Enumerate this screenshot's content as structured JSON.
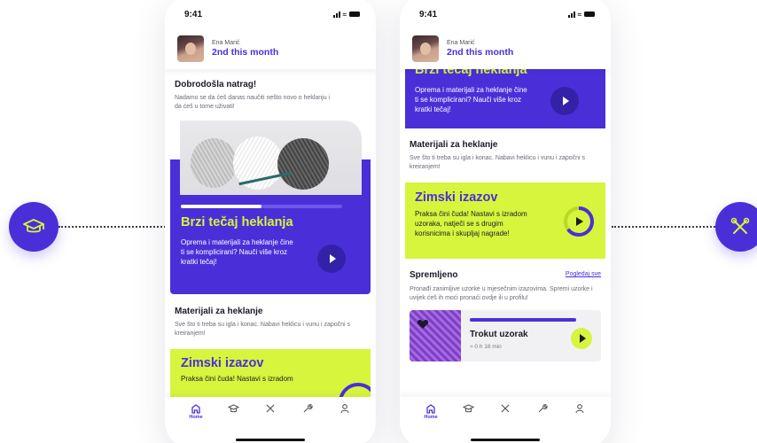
{
  "colors": {
    "accent": "#4a2fd9",
    "lime": "#d6f53c",
    "text": "#1a1a2a"
  },
  "left_circle_icon": "graduation-cap-icon",
  "right_circle_icon": "crossed-tools-icon",
  "phones": [
    {
      "status_time": "9:41",
      "user": {
        "name": "Ena Marić",
        "rank": "2nd this month"
      },
      "welcome": {
        "title": "Dobrodošla natrag!",
        "text": "Nadamo se da ćeš danas naučiti nešto novo o heklanju i da ćeš u tome uživati!"
      },
      "course": {
        "title": "Brzi tečaj heklanja",
        "text": "Oprema i materijali za heklanje čine ti se komplicirani? Nauči više kroz kratki tečaj!",
        "progress": 0.5
      },
      "materials": {
        "title": "Materijali za heklanje",
        "text": "Sve što ti treba su igla i konac. Nabavi heklicu i vunu i započni s kreiranjem!"
      },
      "challenge": {
        "title": "Zimski izazov",
        "text": "Praksa čini čuda! Nastavi s izradom"
      },
      "tabs": [
        "Home"
      ]
    },
    {
      "status_time": "9:41",
      "user": {
        "name": "Ena Marić",
        "rank": "2nd this month"
      },
      "course": {
        "title": "Brzi tečaj heklanja",
        "text": "Oprema i materijali za heklanje čine ti se komplicirani? Nauči više kroz kratki tečaj!"
      },
      "materials": {
        "title": "Materijali za heklanje",
        "text": "Sve što ti treba su igla i konac. Nabavi heklicu i vunu i započni s kreiranjem!"
      },
      "challenge": {
        "title": "Zimski izazov",
        "text": "Praksa čini čuda! Nastavi s izradom uzoraka, natječi se s drugim korisnicima i skupljaj nagrade!",
        "progress": 0.65
      },
      "saved": {
        "title": "Spremljeno",
        "link": "Pogledaj sve",
        "text": "Pronađi zanimljive uzorke u mjesečnim izazovima. Spremi uzorke i uvijek ćeš ih moći pronaći ovdje ili u profilu!"
      },
      "pattern": {
        "title": "Trokut uzorak",
        "duration": "≈ 0 h 16 min",
        "progress": 1.0
      },
      "tabs": [
        "Home"
      ]
    }
  ]
}
